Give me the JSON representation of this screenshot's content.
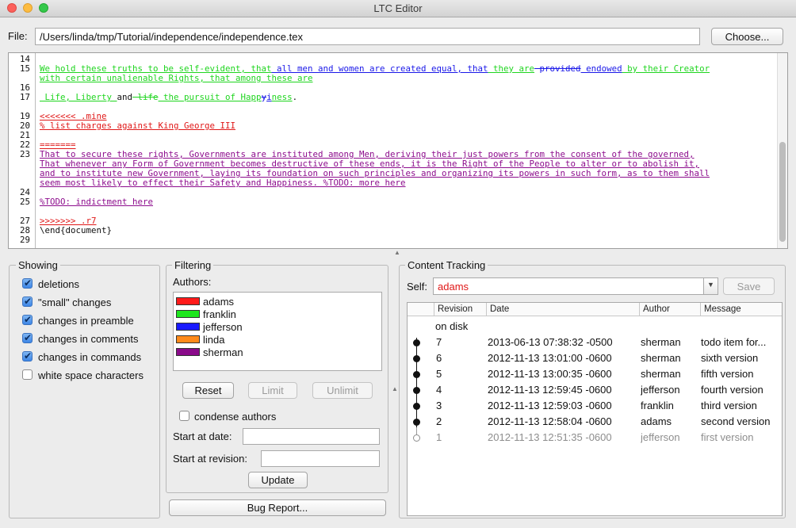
{
  "window": {
    "title": "LTC Editor"
  },
  "file": {
    "label": "File:",
    "path": "/Users/linda/tmp/Tutorial/independence/independence.tex",
    "choose_label": "Choose..."
  },
  "editor": {
    "line_numbers": [
      "14",
      "15",
      "",
      "16",
      "17",
      "",
      "19",
      "20",
      "21",
      "22",
      "23",
      "",
      "",
      "",
      "24",
      "25",
      "",
      "27",
      "28",
      "29"
    ],
    "code_lines": [
      [],
      [
        {
          "t": "We hold these truths to be self-evident, that",
          "c": "g"
        },
        {
          "t": " all men and women are created equal, that",
          "c": "b"
        },
        {
          "t": " they are",
          "c": "g"
        },
        {
          "t": " provided",
          "c": "bs"
        },
        {
          "t": " endowed",
          "c": "b"
        },
        {
          "t": " by their Creator",
          "c": "g"
        }
      ],
      [
        {
          "t": "with certain unalienable Rights, that among these are",
          "c": "g"
        }
      ],
      [],
      [
        {
          "t": " Life, Liberty ",
          "c": "g"
        },
        {
          "t": "and",
          "c": "k"
        },
        {
          "t": " life",
          "c": "gs"
        },
        {
          "t": " the pursuit of Happ",
          "c": "g"
        },
        {
          "t": "y",
          "c": "bs"
        },
        {
          "t": "i",
          "c": "b"
        },
        {
          "t": "ness",
          "c": "g"
        },
        {
          "t": ".",
          "c": "k"
        }
      ],
      [],
      [
        {
          "t": "<<<<<<< .mine",
          "c": "r"
        }
      ],
      [
        {
          "t": "% list charges against King George III",
          "c": "r"
        }
      ],
      [],
      [
        {
          "t": "=======",
          "c": "r"
        }
      ],
      [
        {
          "t": "That to secure these rights, Governments are instituted among Men, deriving their just powers from the consent of the governed,",
          "c": "p"
        }
      ],
      [
        {
          "t": "That whenever any Form of Government becomes destructive of these ends, it is the Right of the People to alter or to abolish it,",
          "c": "p"
        }
      ],
      [
        {
          "t": "and to institute new Government, laying its foundation on such principles and organizing its powers in such form, as to them shall",
          "c": "p"
        }
      ],
      [
        {
          "t": "seem most likely to effect their Safety and Happiness. %TODO: more here",
          "c": "p"
        }
      ],
      [],
      [
        {
          "t": "%TODO: indictment here",
          "c": "p"
        }
      ],
      [],
      [
        {
          "t": ">>>>>>> .r7",
          "c": "r"
        }
      ],
      [
        {
          "t": "\\end{document}",
          "c": "k"
        }
      ],
      []
    ]
  },
  "showing": {
    "title": "Showing",
    "options": [
      {
        "label": "deletions",
        "checked": true
      },
      {
        "label": "\"small\" changes",
        "checked": true
      },
      {
        "label": "changes in preamble",
        "checked": true
      },
      {
        "label": "changes in comments",
        "checked": true
      },
      {
        "label": "changes in commands",
        "checked": true
      },
      {
        "label": "white space characters",
        "checked": false
      }
    ]
  },
  "filtering": {
    "title": "Filtering",
    "authors_label": "Authors:",
    "authors": [
      {
        "name": "adams",
        "color": "#ff1a1a"
      },
      {
        "name": "franklin",
        "color": "#1ee61e"
      },
      {
        "name": "jefferson",
        "color": "#1a1aff"
      },
      {
        "name": "linda",
        "color": "#ff8a1a"
      },
      {
        "name": "sherman",
        "color": "#8a0a8a"
      }
    ],
    "reset_label": "Reset",
    "limit_label": "Limit",
    "unlimit_label": "Unlimit",
    "condense_label": "condense authors",
    "start_date_label": "Start at date:",
    "start_rev_label": "Start at revision:",
    "update_label": "Update"
  },
  "bug_report_label": "Bug Report...",
  "tracking": {
    "title": "Content Tracking",
    "self_label": "Self:",
    "self_value": "adams",
    "self_color": "#e01818",
    "save_label": "Save",
    "columns": [
      "Revision",
      "Date",
      "Author",
      "Message"
    ],
    "rows": [
      {
        "rev": "on disk",
        "date": "",
        "author": "",
        "message": "",
        "dot": "none",
        "dim": false
      },
      {
        "rev": "7",
        "date": "2013-06-13 07:38:32 -0500",
        "author": "sherman",
        "message": "todo item for...",
        "dot": "filled",
        "dim": false
      },
      {
        "rev": "6",
        "date": "2012-11-13 13:01:00 -0600",
        "author": "sherman",
        "message": "sixth version",
        "dot": "filled",
        "dim": false
      },
      {
        "rev": "5",
        "date": "2012-11-13 13:00:35 -0600",
        "author": "sherman",
        "message": "fifth version",
        "dot": "filled",
        "dim": false
      },
      {
        "rev": "4",
        "date": "2012-11-13 12:59:45 -0600",
        "author": "jefferson",
        "message": "fourth version",
        "dot": "filled",
        "dim": false
      },
      {
        "rev": "3",
        "date": "2012-11-13 12:59:03 -0600",
        "author": "franklin",
        "message": "third version",
        "dot": "filled",
        "dim": false
      },
      {
        "rev": "2",
        "date": "2012-11-13 12:58:04 -0600",
        "author": "adams",
        "message": "second version",
        "dot": "filled",
        "dim": false
      },
      {
        "rev": "1",
        "date": "2012-11-13 12:51:35 -0600",
        "author": "jefferson",
        "message": "first version",
        "dot": "hollow",
        "dim": true
      }
    ]
  }
}
